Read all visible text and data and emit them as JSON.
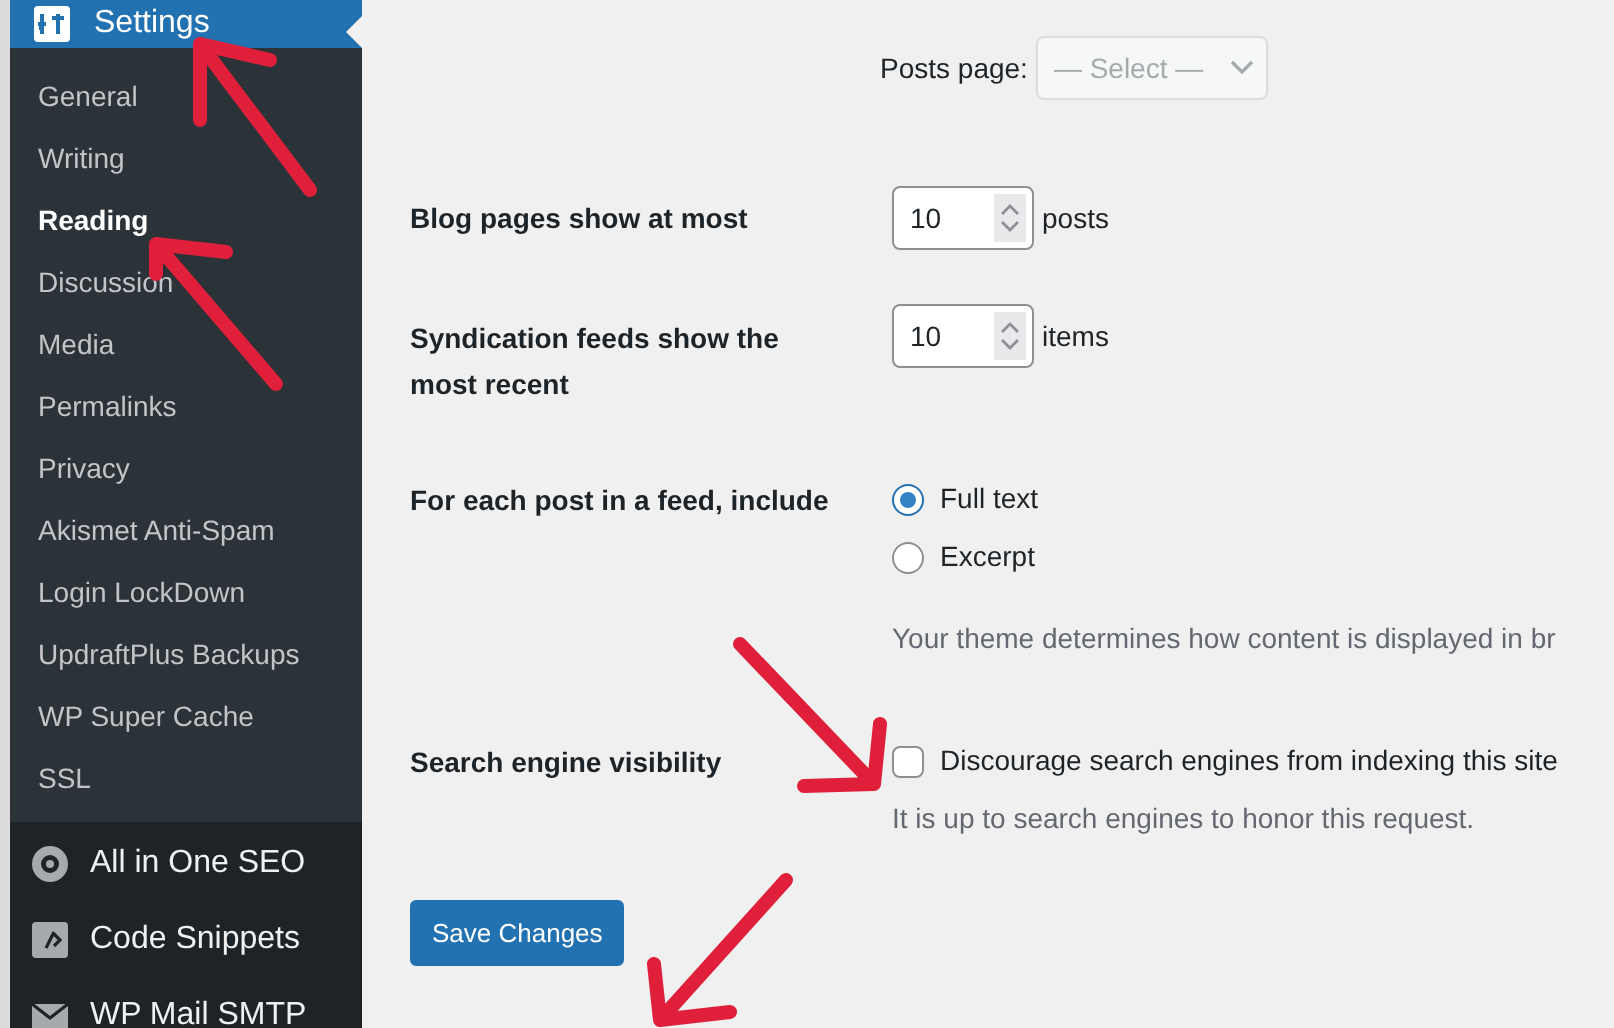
{
  "sidebar": {
    "header": {
      "label": "Settings",
      "selected": true
    },
    "items": [
      {
        "label": "General",
        "selected": false
      },
      {
        "label": "Writing",
        "selected": false
      },
      {
        "label": "Reading",
        "selected": true
      },
      {
        "label": "Discussion",
        "selected": false
      },
      {
        "label": "Media",
        "selected": false
      },
      {
        "label": "Permalinks",
        "selected": false
      },
      {
        "label": "Privacy",
        "selected": false
      },
      {
        "label": "Akismet Anti-Spam",
        "selected": false
      },
      {
        "label": "Login LockDown",
        "selected": false
      },
      {
        "label": "UpdraftPlus Backups",
        "selected": false
      },
      {
        "label": "WP Super Cache",
        "selected": false
      },
      {
        "label": "SSL",
        "selected": false
      }
    ],
    "menu": [
      {
        "label": "All in One SEO",
        "kind": "gear"
      },
      {
        "label": "Code Snippets",
        "kind": "code"
      },
      {
        "label": "WP Mail SMTP",
        "kind": "mail"
      }
    ]
  },
  "posts_page": {
    "label": "Posts page:",
    "placeholder": "— Select —",
    "disabled": true
  },
  "rows": [
    {
      "kind": "number",
      "label": "Blog pages show at most",
      "value": "10",
      "unit": "posts"
    },
    {
      "kind": "number",
      "label": "Syndication feeds show the most recent",
      "value": "10",
      "unit": "items"
    },
    {
      "kind": "radio",
      "label": "For each post in a feed, include",
      "options": [
        {
          "label": "Full text",
          "selected": true
        },
        {
          "label": "Excerpt",
          "selected": false
        }
      ],
      "description": "Your theme determines how content is displayed in br"
    },
    {
      "kind": "checkbox",
      "label": "Search engine visibility",
      "option": "Discourage search engines from indexing this site",
      "checked": false,
      "description": "It is up to search engines to honor this request."
    }
  ],
  "save_button": "Save Changes"
}
